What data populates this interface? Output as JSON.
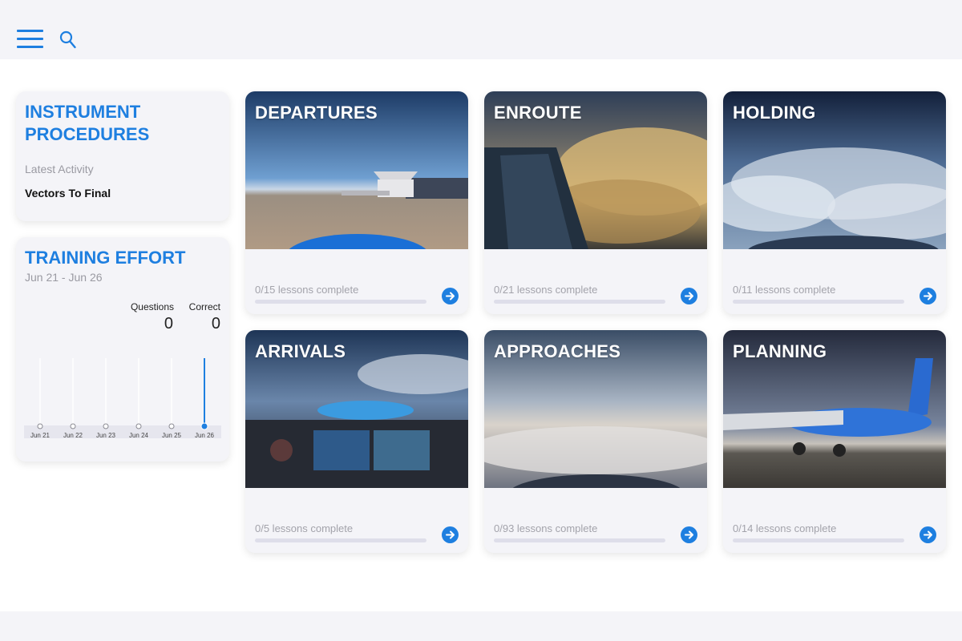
{
  "header": {
    "menu_icon": "hamburger-menu-icon",
    "search_icon": "search-icon",
    "accent_color": "#1e7fe0"
  },
  "instrument_procedures": {
    "title": "INSTRUMENT PROCEDURES",
    "latest_activity_label": "Latest Activity",
    "latest_activity_value": "Vectors To Final"
  },
  "training_effort": {
    "title": "TRAINING EFFORT",
    "date_range": "Jun 21 - Jun 26",
    "questions_label": "Questions",
    "questions_value": "0",
    "correct_label": "Correct",
    "correct_value": "0",
    "chart": {
      "days": [
        "Jun 21",
        "Jun 22",
        "Jun 23",
        "Jun 24",
        "Jun 25",
        "Jun 26"
      ],
      "selected_index": 5
    }
  },
  "categories": [
    {
      "title": "DEPARTURES",
      "progress_text": "0/15 lessons complete",
      "progress": 0
    },
    {
      "title": "ENROUTE",
      "progress_text": "0/21 lessons complete",
      "progress": 0
    },
    {
      "title": "HOLDING",
      "progress_text": "0/11 lessons complete",
      "progress": 0
    },
    {
      "title": "ARRIVALS",
      "progress_text": "0/5 lessons complete",
      "progress": 0
    },
    {
      "title": "APPROACHES",
      "progress_text": "0/93 lessons complete",
      "progress": 0
    },
    {
      "title": "PLANNING",
      "progress_text": "0/14 lessons complete",
      "progress": 0
    }
  ]
}
